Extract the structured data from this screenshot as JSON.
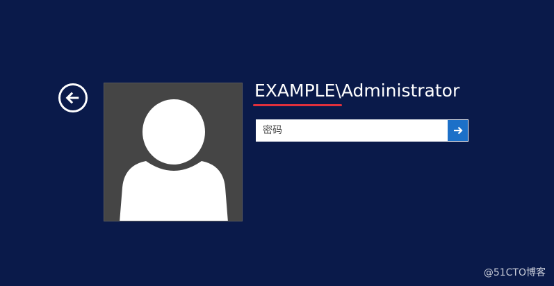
{
  "screen": {
    "background_color": "#0a1a4a"
  },
  "back_button": {
    "icon": "arrow-left-icon"
  },
  "user_tile": {
    "icon": "user-silhouette-icon",
    "tile_color": "#454545"
  },
  "account": {
    "name": "EXAMPLE\\Administrator",
    "underline_color": "#e0303c"
  },
  "password": {
    "placeholder": "密码",
    "value": ""
  },
  "submit_button": {
    "icon": "arrow-right-icon",
    "color": "#1c70c8"
  },
  "watermark": {
    "text": "@51CTO博客"
  }
}
